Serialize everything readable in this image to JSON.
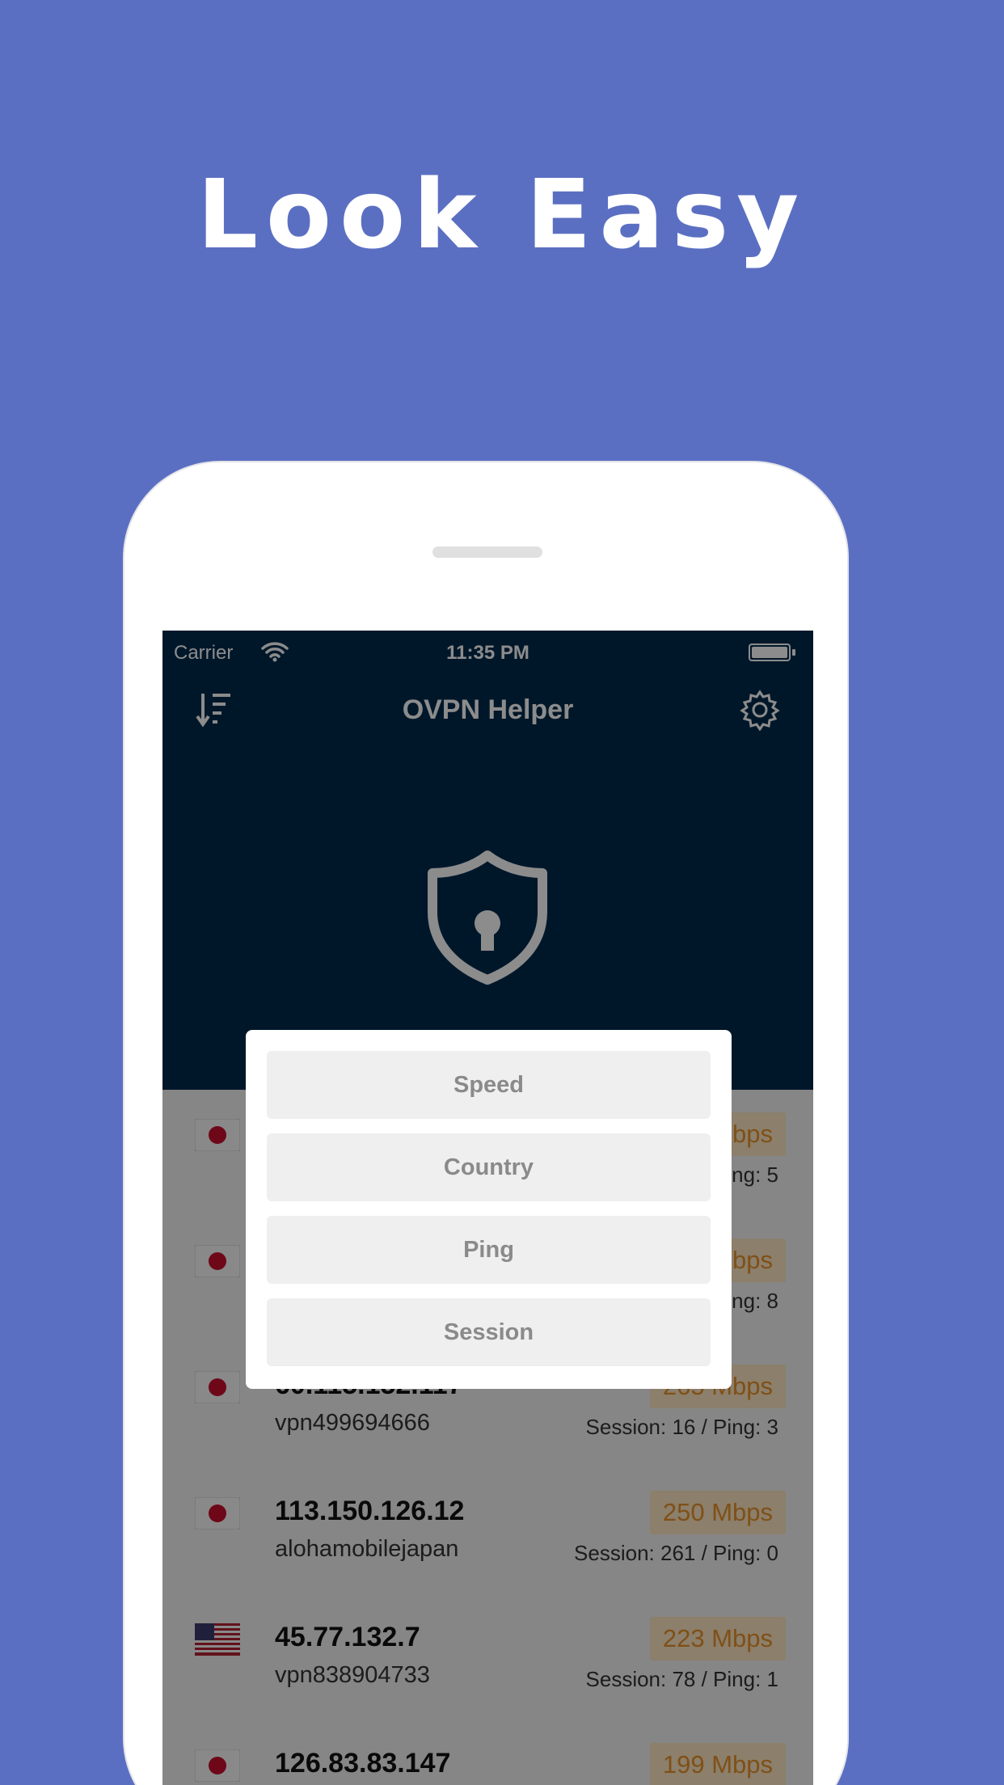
{
  "headline": "Look Easy",
  "status_bar": {
    "carrier": "Carrier",
    "time": "11:35 PM"
  },
  "navbar": {
    "title": "OVPN Helper"
  },
  "sort_options": [
    "Speed",
    "Country",
    "Ping",
    "Session"
  ],
  "servers": [
    {
      "flag": "japan-flag-icon",
      "ip": "",
      "host": "",
      "speed": "bps",
      "meta": "ng: 5"
    },
    {
      "flag": "japan-flag-icon",
      "ip": "",
      "host": "",
      "speed": "bps",
      "meta": "ng: 8"
    },
    {
      "flag": "japan-flag-icon",
      "ip": "60.115.152.117",
      "host": "vpn499694666",
      "speed": "265 Mbps",
      "meta": "Session: 16 / Ping: 3"
    },
    {
      "flag": "japan-flag-icon",
      "ip": "113.150.126.12",
      "host": "alohamobilejapan",
      "speed": "250 Mbps",
      "meta": "Session: 261 / Ping: 0"
    },
    {
      "flag": "usa-flag-icon",
      "ip": "45.77.132.7",
      "host": "vpn838904733",
      "speed": "223 Mbps",
      "meta": "Session: 78 / Ping: 1"
    },
    {
      "flag": "japan-flag-icon",
      "ip": "126.83.83.147",
      "host": "",
      "speed": "199 Mbps",
      "meta": ""
    }
  ],
  "colors": {
    "background": "#5b6fc2",
    "header": "#012b4d",
    "speed_badge_text": "#e8922a",
    "speed_badge_bg": "#ffe7c4"
  }
}
